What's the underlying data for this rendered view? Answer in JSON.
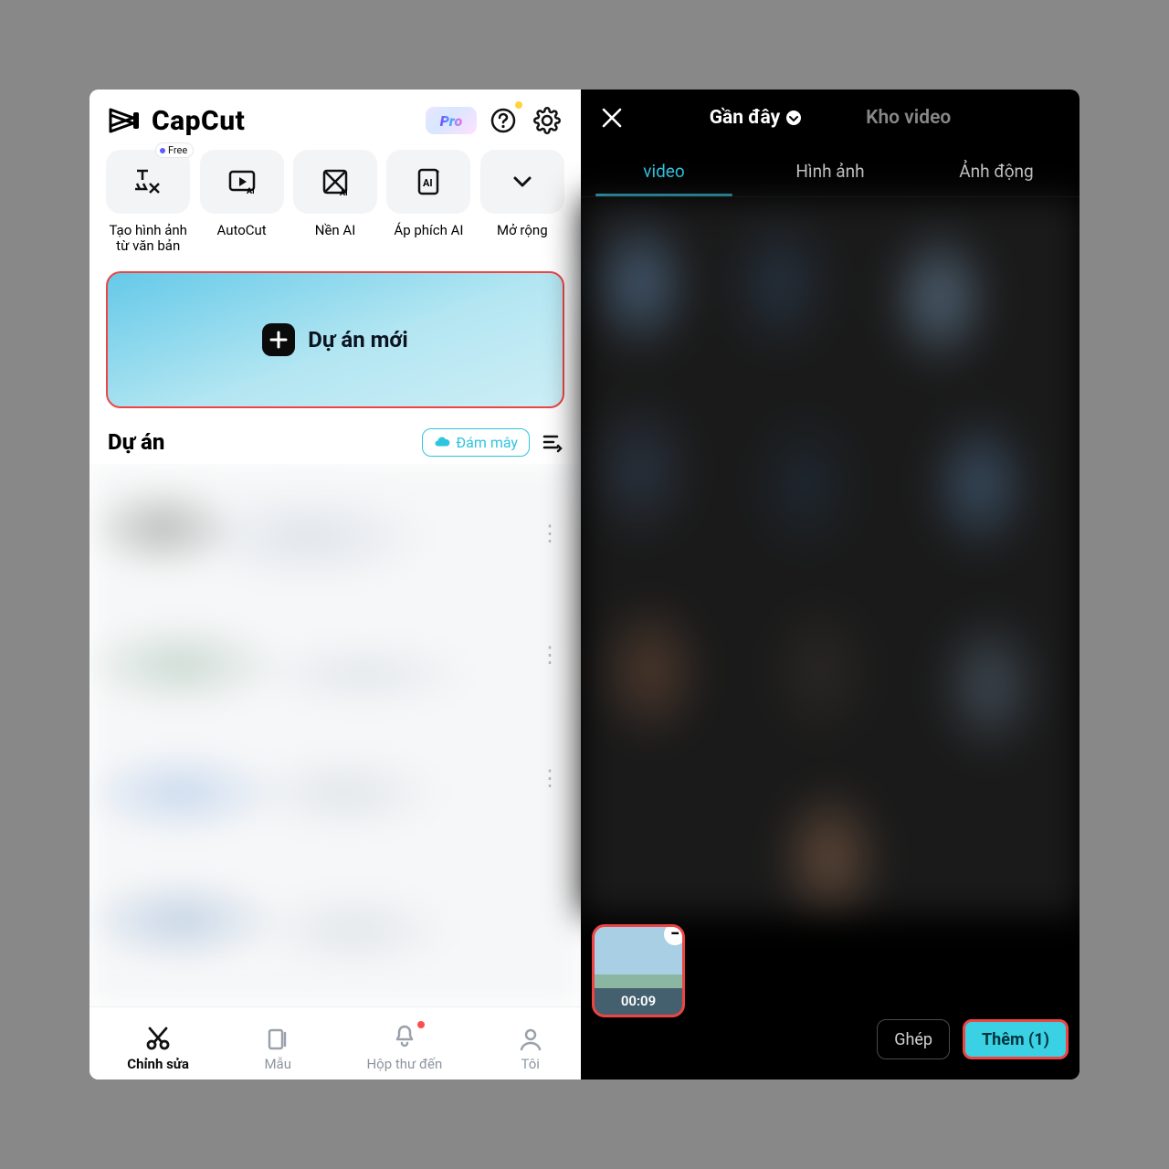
{
  "left": {
    "brand": "CapCut",
    "pro_label": "Pro",
    "tools": [
      {
        "name": "text-to-image",
        "label": "Tạo hình ảnh từ văn bản",
        "free_label": "Free"
      },
      {
        "name": "autocut",
        "label": "AutoCut"
      },
      {
        "name": "ai-bg",
        "label": "Nền AI"
      },
      {
        "name": "ai-poster",
        "label": "Áp phích AI"
      },
      {
        "name": "expand",
        "label": "Mở rộng"
      }
    ],
    "new_project_label": "Dự án mới",
    "projects_heading": "Dự án",
    "cloud_label": "Đám mây",
    "tabs": [
      {
        "name": "edit",
        "label": "Chỉnh sửa"
      },
      {
        "name": "templates",
        "label": "Mẫu"
      },
      {
        "name": "inbox",
        "label": "Hộp thư đến"
      },
      {
        "name": "me",
        "label": "Tôi"
      }
    ]
  },
  "right": {
    "source_recent": "Gần đây",
    "source_library": "Kho video",
    "media_tabs": {
      "video": "video",
      "image": "Hình ảnh",
      "gif": "Ảnh động"
    },
    "selected_duration": "00:09",
    "btn_merge": "Ghép",
    "btn_add": "Thêm (1)"
  }
}
